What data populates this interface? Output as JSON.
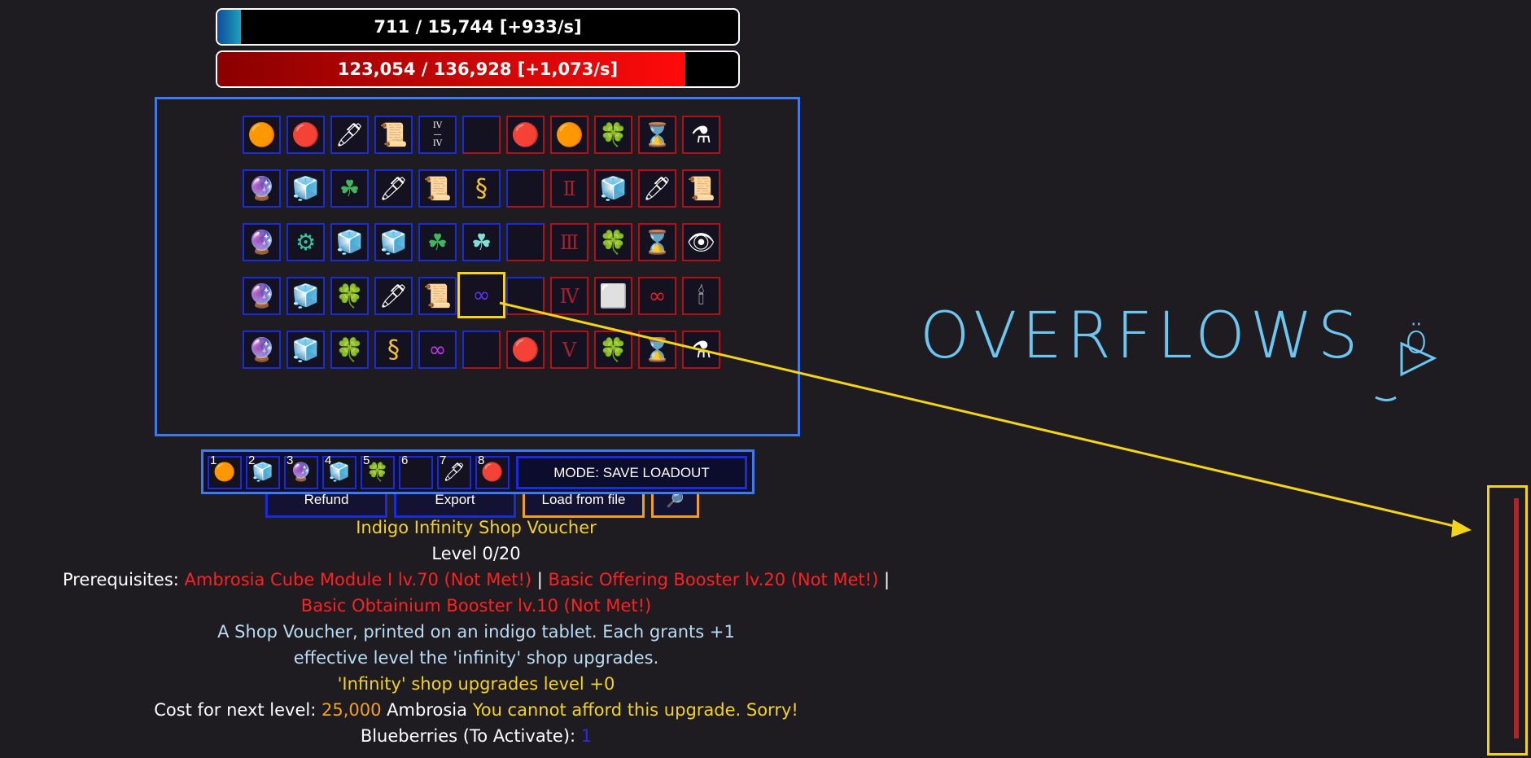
{
  "resource_bars": {
    "blueberries": {
      "text": "711 / 15,744 [+933/s]",
      "fill_fraction": 0.045
    },
    "ambrosia": {
      "text": "123,054 / 136,928 [+1,073/s]",
      "fill_fraction": 0.8987
    }
  },
  "grid": {
    "rows": [
      [
        {
          "icon": "orange-blob-icon",
          "glyph": "🟠",
          "border": "blue"
        },
        {
          "icon": "red-pill-icon",
          "glyph": "🔴",
          "border": "blue"
        },
        {
          "icon": "blue-wand-icon",
          "glyph": "🖊",
          "border": "blue"
        },
        {
          "icon": "scroll-icon",
          "glyph": "📜",
          "border": "blue"
        },
        {
          "icon": "iv-fraction-icon",
          "glyph": "IV/IV",
          "border": "blue"
        },
        {
          "icon": "empty-slot-icon",
          "glyph": "",
          "border": "mixed"
        },
        {
          "icon": "red-blob-icon",
          "glyph": "🔴",
          "border": "red"
        },
        {
          "icon": "orange-blob-icon",
          "glyph": "🟠",
          "border": "red"
        },
        {
          "icon": "clover-icon",
          "glyph": "🍀",
          "border": "red"
        },
        {
          "icon": "hourglass-icon",
          "glyph": "⌛",
          "border": "red"
        },
        {
          "icon": "potion-icon",
          "glyph": "⚗",
          "border": "red"
        }
      ],
      [
        {
          "icon": "crystal-orb-icon",
          "glyph": "🔮",
          "border": "blue"
        },
        {
          "icon": "cubes-icon",
          "glyph": "🧊",
          "border": "blue"
        },
        {
          "icon": "clover-icon",
          "glyph": "☘",
          "border": "blue"
        },
        {
          "icon": "blue-wand-icon",
          "glyph": "🖊",
          "border": "blue"
        },
        {
          "icon": "scroll-icon",
          "glyph": "📜",
          "border": "blue"
        },
        {
          "icon": "golden-s-icon",
          "glyph": "§",
          "border": "blue"
        },
        {
          "icon": "empty-slot-icon",
          "glyph": "",
          "border": "mixed"
        },
        {
          "icon": "roman-two-icon",
          "glyph": "Ⅱ",
          "border": "red"
        },
        {
          "icon": "cubes-icon",
          "glyph": "🧊",
          "border": "red"
        },
        {
          "icon": "blue-wand-icon",
          "glyph": "🖊",
          "border": "red"
        },
        {
          "icon": "scroll-icon",
          "glyph": "📜",
          "border": "red"
        }
      ],
      [
        {
          "icon": "crystal-orb-icon",
          "glyph": "🔮",
          "border": "blue"
        },
        {
          "icon": "green-gear-icon",
          "glyph": "⚙",
          "border": "blue"
        },
        {
          "icon": "cubes-icon",
          "glyph": "🧊",
          "border": "blue"
        },
        {
          "icon": "cubes-icon",
          "glyph": "🧊",
          "border": "blue"
        },
        {
          "icon": "clover-icon",
          "glyph": "☘",
          "border": "blue"
        },
        {
          "icon": "clover-icon",
          "glyph": "☘",
          "border": "blue"
        },
        {
          "icon": "empty-slot-icon",
          "glyph": "",
          "border": "mixed"
        },
        {
          "icon": "roman-three-icon",
          "glyph": "Ⅲ",
          "border": "red"
        },
        {
          "icon": "clover-icon",
          "glyph": "🍀",
          "border": "red"
        },
        {
          "icon": "hourglass-icon",
          "glyph": "⌛",
          "border": "red"
        },
        {
          "icon": "red-eye-icon",
          "glyph": "👁",
          "border": "red"
        }
      ],
      [
        {
          "icon": "crystal-orb-icon",
          "glyph": "🔮",
          "border": "blue"
        },
        {
          "icon": "cubes-icon",
          "glyph": "🧊",
          "border": "blue"
        },
        {
          "icon": "clover-icon",
          "glyph": "🍀",
          "border": "blue"
        },
        {
          "icon": "blue-wand-icon",
          "glyph": "🖊",
          "border": "blue"
        },
        {
          "icon": "scroll-icon",
          "glyph": "📜",
          "border": "blue"
        },
        {
          "icon": "indigo-infinity-icon",
          "glyph": "∞",
          "border": "selected"
        },
        {
          "icon": "empty-slot-icon",
          "glyph": "",
          "border": "mixed"
        },
        {
          "icon": "roman-four-icon",
          "glyph": "Ⅳ",
          "border": "red"
        },
        {
          "icon": "white-cubes-icon",
          "glyph": "⬜",
          "border": "red"
        },
        {
          "icon": "red-infinity-icon",
          "glyph": "∞",
          "border": "red"
        },
        {
          "icon": "red-figure-icon",
          "glyph": "🕯",
          "border": "red"
        }
      ],
      [
        {
          "icon": "crystal-orb-icon",
          "glyph": "🔮",
          "border": "blue"
        },
        {
          "icon": "cubes-icon",
          "glyph": "🧊",
          "border": "blue"
        },
        {
          "icon": "clover-icon",
          "glyph": "🍀",
          "border": "blue"
        },
        {
          "icon": "golden-s-icon",
          "glyph": "§",
          "border": "blue"
        },
        {
          "icon": "purple-infinity-icon",
          "glyph": "∞",
          "border": "blue"
        },
        {
          "icon": "empty-slot-icon",
          "glyph": "",
          "border": "mixed"
        },
        {
          "icon": "red-blob-icon",
          "glyph": "🔴",
          "border": "red"
        },
        {
          "icon": "roman-five-icon",
          "glyph": "Ⅴ",
          "border": "red"
        },
        {
          "icon": "clover-icon",
          "glyph": "🍀",
          "border": "red"
        },
        {
          "icon": "hourglass-icon",
          "glyph": "⌛",
          "border": "red"
        },
        {
          "icon": "potion-icon",
          "glyph": "⚗",
          "border": "red"
        }
      ]
    ]
  },
  "buttons": {
    "refund": "Refund",
    "export": "Export",
    "load_from_file": "Load from file",
    "search_glyph": "🔎"
  },
  "loadout": {
    "slots": [
      {
        "num": "1",
        "icon": "orange-blob-icon",
        "glyph": "🟠"
      },
      {
        "num": "2",
        "icon": "cubes-icon",
        "glyph": "🧊"
      },
      {
        "num": "3",
        "icon": "crystal-orb-icon",
        "glyph": "🔮"
      },
      {
        "num": "4",
        "icon": "cubes-icon",
        "glyph": "🧊"
      },
      {
        "num": "5",
        "icon": "clover-icon",
        "glyph": "🍀"
      },
      {
        "num": "6",
        "icon": "empty-slot-icon",
        "glyph": ""
      },
      {
        "num": "7",
        "icon": "blue-wand-icon",
        "glyph": "🖊"
      },
      {
        "num": "8",
        "icon": "red-pill-icon",
        "glyph": "🔴"
      }
    ],
    "mode_label": "MODE: SAVE LOADOUT"
  },
  "description": {
    "title": "Indigo Infinity Shop Voucher",
    "level": "Level 0/20",
    "prereq_label": "Prerequisites:",
    "prereq_1": "Ambrosia Cube Module I lv.70 (Not Met!)",
    "prereq_2": "Basic Offering Booster lv.20 (Not Met!)",
    "prereq_3": "Basic Obtainium Booster lv.10 (Not Met!)",
    "separator": "|",
    "body": "A Shop Voucher, printed on an indigo tablet. Each grants +1 effective level the 'infinity' shop upgrades.",
    "effect": "'Infinity' shop upgrades level +0",
    "cost_label": "Cost for next level:",
    "cost_value": "25,000",
    "cost_unit": "Ambrosia",
    "afford_msg": "You cannot afford this upgrade. Sorry!",
    "blueberries_label": "Blueberries (To Activate):",
    "blueberries_value": "1"
  },
  "annotation": {
    "handwritten_note": "OVERFLOWS",
    "note_doodle": "ö",
    "colors": {
      "arrow": "#f4d31b",
      "note": "#6cc6f2"
    }
  }
}
